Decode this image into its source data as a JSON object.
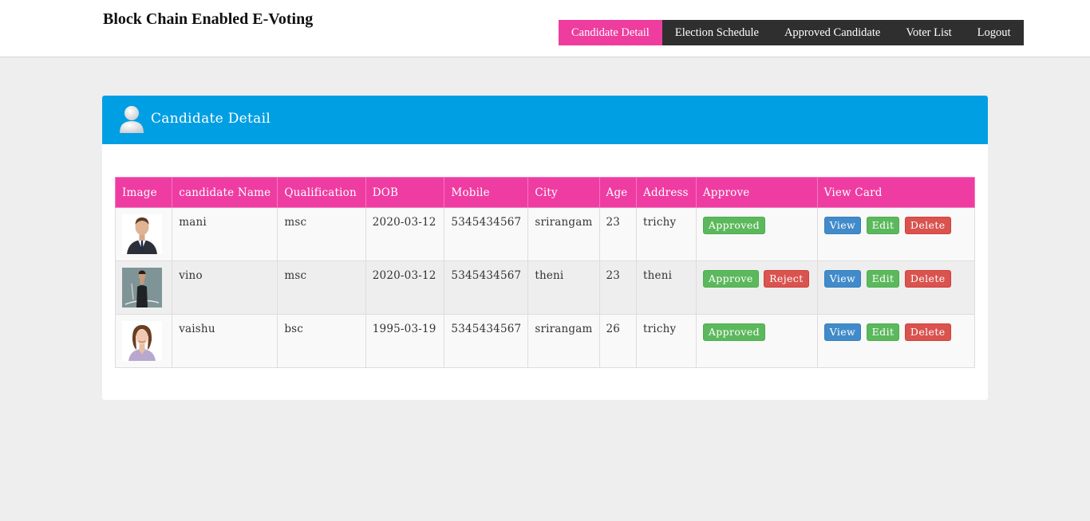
{
  "header": {
    "brand": "Block Chain Enabled E-Voting",
    "nav": [
      {
        "label": "Candidate Detail",
        "active": true
      },
      {
        "label": "Election Schedule",
        "active": false
      },
      {
        "label": "Approved Candidate",
        "active": false
      },
      {
        "label": "Voter List",
        "active": false
      },
      {
        "label": "Logout",
        "active": false
      }
    ]
  },
  "panel": {
    "title": "Candidate Detail",
    "icon": "user-icon"
  },
  "table": {
    "columns": [
      "Image",
      "candidate Name",
      "Qualification",
      "DOB",
      "Mobile",
      "City",
      "Age",
      "Address",
      "Approve",
      "View Card"
    ],
    "rows": [
      {
        "name": "mani",
        "qualification": "msc",
        "dob": "2020-03-12",
        "mobile": "5345434567",
        "city": "srirangam",
        "age": "23",
        "address": "trichy",
        "photo": "man-in-suit-photo",
        "approve": [
          {
            "label": "Approved",
            "style": "success"
          }
        ]
      },
      {
        "name": "vino",
        "qualification": "msc",
        "dob": "2020-03-12",
        "mobile": "5345434567",
        "city": "theni",
        "age": "23",
        "address": "theni",
        "photo": "man-with-rope-photo",
        "approve": [
          {
            "label": "Approve",
            "style": "success"
          },
          {
            "label": "Reject",
            "style": "danger"
          }
        ]
      },
      {
        "name": "vaishu",
        "qualification": "bsc",
        "dob": "1995-03-19",
        "mobile": "5345434567",
        "city": "srirangam",
        "age": "26",
        "address": "trichy",
        "photo": "woman-portrait-photo",
        "approve": [
          {
            "label": "Approved",
            "style": "success"
          }
        ]
      }
    ],
    "actions": [
      {
        "label": "View",
        "style": "primary"
      },
      {
        "label": "Edit",
        "style": "success"
      },
      {
        "label": "Delete",
        "style": "danger"
      }
    ]
  },
  "colors": {
    "nav_active": "#ee3c9f",
    "nav_bg": "#2f2f2f",
    "panel_header": "#009fe3",
    "table_header": "#ee3ca2",
    "success": "#5cb85c",
    "danger": "#d9534f",
    "primary": "#428bca"
  }
}
